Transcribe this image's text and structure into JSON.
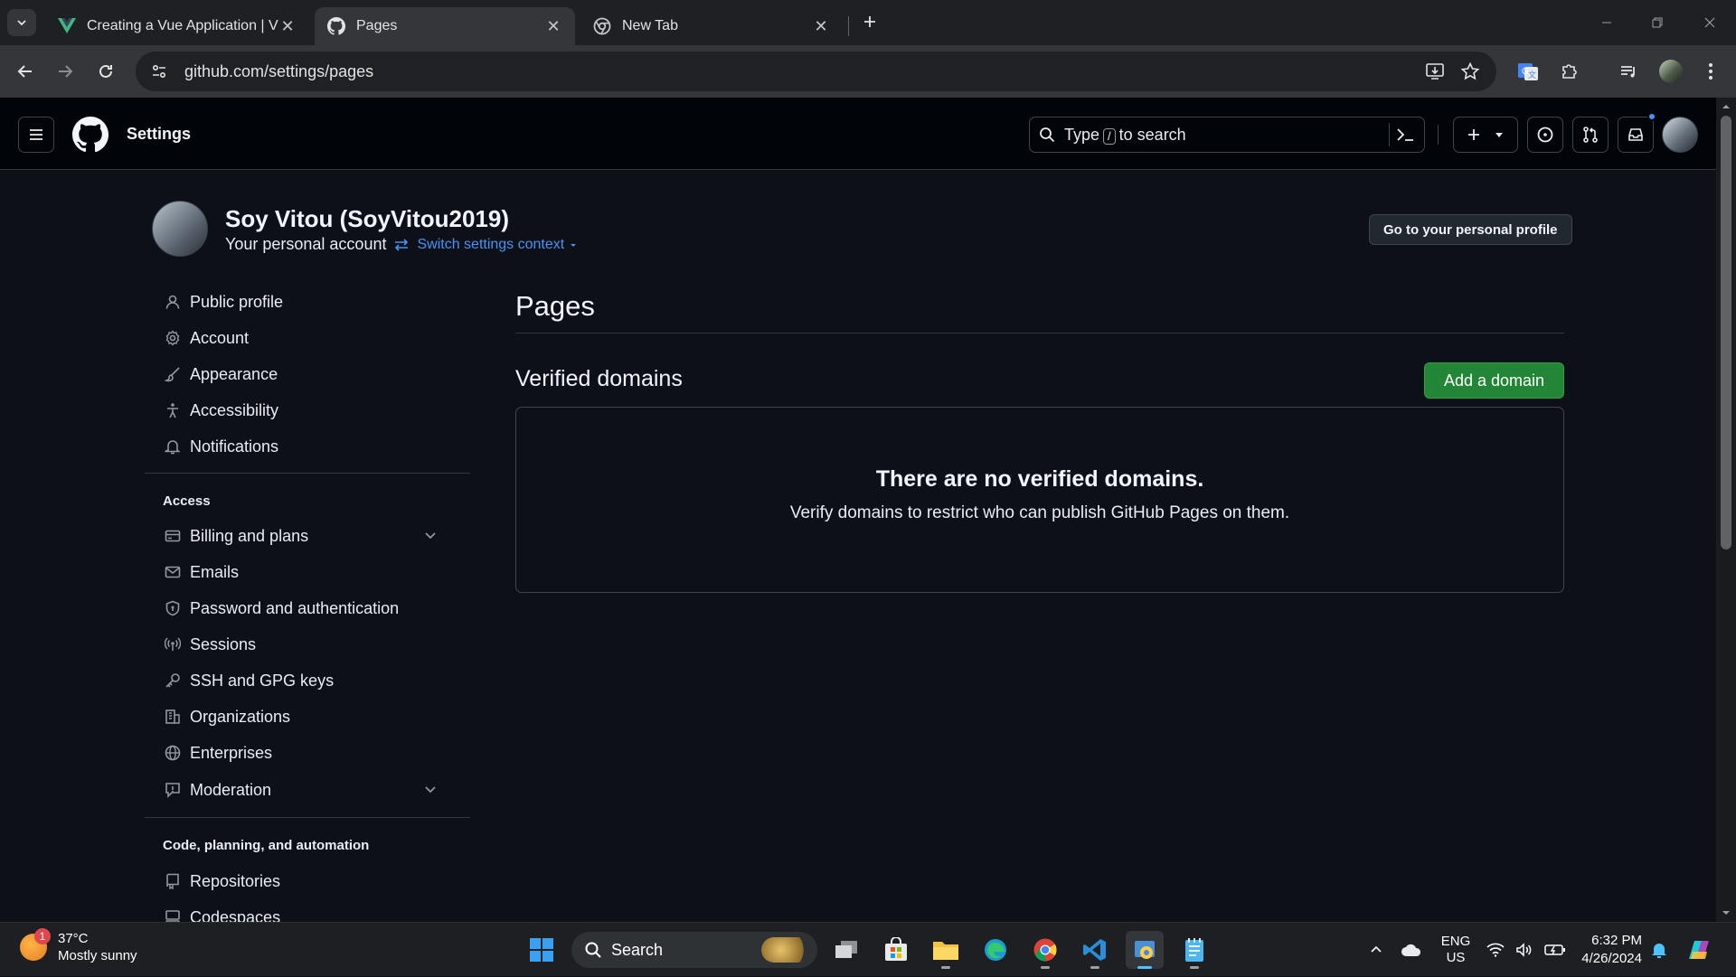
{
  "browser": {
    "tabs": [
      {
        "title": "Creating a Vue Application | Vu",
        "favicon": "vue-icon",
        "active": false
      },
      {
        "title": "Pages",
        "favicon": "github-icon",
        "active": true
      },
      {
        "title": "New Tab",
        "favicon": "chrome-icon",
        "active": false
      }
    ],
    "url": "github.com/settings/pages"
  },
  "github": {
    "header_title": "Settings",
    "search_prefix": "Type",
    "search_key": "/",
    "search_suffix": "to search"
  },
  "context": {
    "name": "Soy Vitou (SoyVitou2019)",
    "subtitle": "Your personal account",
    "switch_label": "Switch settings context",
    "profile_button": "Go to your personal profile"
  },
  "sidebar": {
    "items": [
      {
        "label": "Public profile",
        "icon": "person-icon"
      },
      {
        "label": "Account",
        "icon": "gear-icon"
      },
      {
        "label": "Appearance",
        "icon": "paintbrush-icon"
      },
      {
        "label": "Accessibility",
        "icon": "accessibility-icon"
      },
      {
        "label": "Notifications",
        "icon": "bell-icon"
      }
    ],
    "access_heading": "Access",
    "access_items": [
      {
        "label": "Billing and plans",
        "icon": "credit-card-icon"
      },
      {
        "label": "Emails",
        "icon": "mail-icon"
      },
      {
        "label": "Password and authentication",
        "icon": "shield-icon"
      },
      {
        "label": "Sessions",
        "icon": "broadcast-icon"
      },
      {
        "label": "SSH and GPG keys",
        "icon": "key-icon"
      },
      {
        "label": "Organizations",
        "icon": "organization-icon"
      },
      {
        "label": "Enterprises",
        "icon": "globe-icon"
      },
      {
        "label": "Moderation",
        "icon": "report-icon"
      }
    ],
    "code_heading": "Code, planning, and automation",
    "code_items": [
      {
        "label": "Repositories",
        "icon": "repo-icon"
      },
      {
        "label": "Codespaces",
        "icon": "codespaces-icon"
      }
    ]
  },
  "content": {
    "page_title": "Pages",
    "section_title": "Verified domains",
    "add_button": "Add a domain",
    "empty_title": "There are no verified domains.",
    "empty_text": "Verify domains to restrict who can publish GitHub Pages on them."
  },
  "taskbar": {
    "weather_temp": "37°C",
    "weather_desc": "Mostly sunny",
    "weather_badge": "1",
    "search_label": "Search",
    "lang_1": "ENG",
    "lang_2": "US",
    "time": "6:32 PM",
    "date": "4/26/2024"
  },
  "colors": {
    "accent_blue": "#4493f8",
    "button_green": "#238636",
    "background": "#0d1117"
  }
}
